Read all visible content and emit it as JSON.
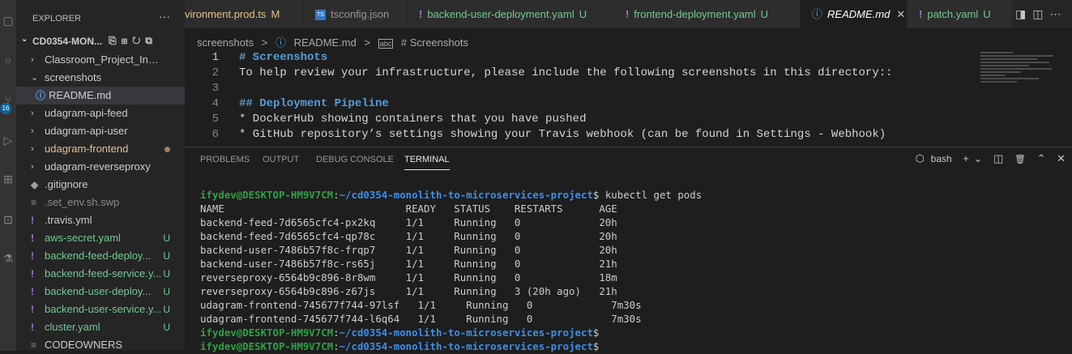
{
  "activity_bar": {
    "icons": [
      "files-icon",
      "search-icon",
      "source-control-icon",
      "run-debug-icon",
      "extensions-icon",
      "remote-explorer-icon",
      "testing-icon"
    ],
    "source_control_badge": "16"
  },
  "sidebar": {
    "title": "EXPLORER",
    "more": "···",
    "folder": "CD0354-MON...",
    "items": [
      {
        "label": "Classroom_Project_Instructi...",
        "kind": "folder",
        "expanded": false,
        "status": ""
      },
      {
        "label": "screenshots",
        "kind": "folder",
        "expanded": true,
        "status": ""
      },
      {
        "label": "README.md",
        "kind": "info",
        "status": "",
        "selected": true
      },
      {
        "label": "udagram-api-feed",
        "kind": "folder",
        "expanded": false,
        "status": ""
      },
      {
        "label": "udagram-api-user",
        "kind": "folder",
        "expanded": false,
        "status": ""
      },
      {
        "label": "udagram-frontend",
        "kind": "folder",
        "expanded": false,
        "status": "dot"
      },
      {
        "label": "udagram-reverseproxy",
        "kind": "folder",
        "expanded": false,
        "status": ""
      },
      {
        "label": ".gitignore",
        "kind": "git",
        "status": ""
      },
      {
        "label": ".set_env.sh.swp",
        "kind": "lines",
        "status": ""
      },
      {
        "label": ".travis.yml",
        "kind": "yaml",
        "status": ""
      },
      {
        "label": "aws-secret.yaml",
        "kind": "yaml",
        "status": "U"
      },
      {
        "label": "backend-feed-deploy...",
        "kind": "yaml",
        "status": "U"
      },
      {
        "label": "backend-feed-service.y...",
        "kind": "yaml",
        "status": "U"
      },
      {
        "label": "backend-user-deploy...",
        "kind": "yaml",
        "status": "U"
      },
      {
        "label": "backend-user-service.y...",
        "kind": "yaml",
        "status": "U"
      },
      {
        "label": "cluster.yaml",
        "kind": "yaml",
        "status": "U"
      },
      {
        "label": "CODEOWNERS",
        "kind": "lines",
        "status": ""
      }
    ]
  },
  "tabs": [
    {
      "label": "vironment.prod.ts",
      "icon": "",
      "status": "M",
      "active": false
    },
    {
      "label": "tsconfig.json",
      "icon": "ts",
      "status": "",
      "active": false
    },
    {
      "label": "backend-user-deployment.yaml",
      "icon": "!",
      "status": "U",
      "active": false
    },
    {
      "label": "frontend-deployment.yaml",
      "icon": "!",
      "status": "U",
      "active": false
    },
    {
      "label": "README.md",
      "icon": "ⓘ",
      "status": "",
      "active": true,
      "close": "✕"
    },
    {
      "label": "patch.yaml",
      "icon": "!",
      "status": "U",
      "active": false
    }
  ],
  "breadcrumb": {
    "folder": "screenshots",
    "sep": ">",
    "file": "README.md",
    "symbol": "# Screenshots"
  },
  "editor": {
    "lines": [
      {
        "n": "1",
        "text": "# Screenshots",
        "heading": true
      },
      {
        "n": "2",
        "text": "To help review your infrastructure, please include the following screenshots in this directory::",
        "heading": false
      },
      {
        "n": "3",
        "text": "",
        "heading": false
      },
      {
        "n": "4",
        "text": "## Deployment Pipeline",
        "heading": true
      },
      {
        "n": "5",
        "text": "* DockerHub showing containers that you have pushed",
        "heading": false
      },
      {
        "n": "6",
        "text": "* GitHub repository’s settings showing your Travis webhook (can be found in Settings - Webhook)",
        "heading": false
      }
    ]
  },
  "panel": {
    "tabs": [
      "PROBLEMS",
      "OUTPUT",
      "DEBUG CONSOLE",
      "TERMINAL"
    ],
    "active_tab": "TERMINAL",
    "shell": "bash",
    "actions": [
      "+",
      "⌄",
      "◫",
      "🗑",
      "⌃",
      "✕"
    ]
  },
  "terminal": {
    "prompt_user": "ifydev@DESKTOP-HM9V7CM",
    "prompt_path": "~/cd0354-monolith-to-microservices-project",
    "command": "kubectl get pods",
    "header": "NAME                              READY   STATUS    RESTARTS      AGE",
    "rows": [
      "backend-feed-7d6565cfc4-px2kq     1/1     Running   0             20h",
      "backend-feed-7d6565cfc4-qp78c     1/1     Running   0             20h",
      "backend-user-7486b57f8c-frqp7     1/1     Running   0             20h",
      "backend-user-7486b57f8c-rs65j     1/1     Running   0             21h",
      "reverseproxy-6564b9c896-8r8wm     1/1     Running   0             18m",
      "reverseproxy-6564b9c896-z67js     1/1     Running   3 (20h ago)   21h",
      "udagram-frontend-745677f744-97lsf   1/1     Running   0             7m30s",
      "udagram-frontend-745677f744-l6q64   1/1     Running   0             7m30s"
    ]
  }
}
